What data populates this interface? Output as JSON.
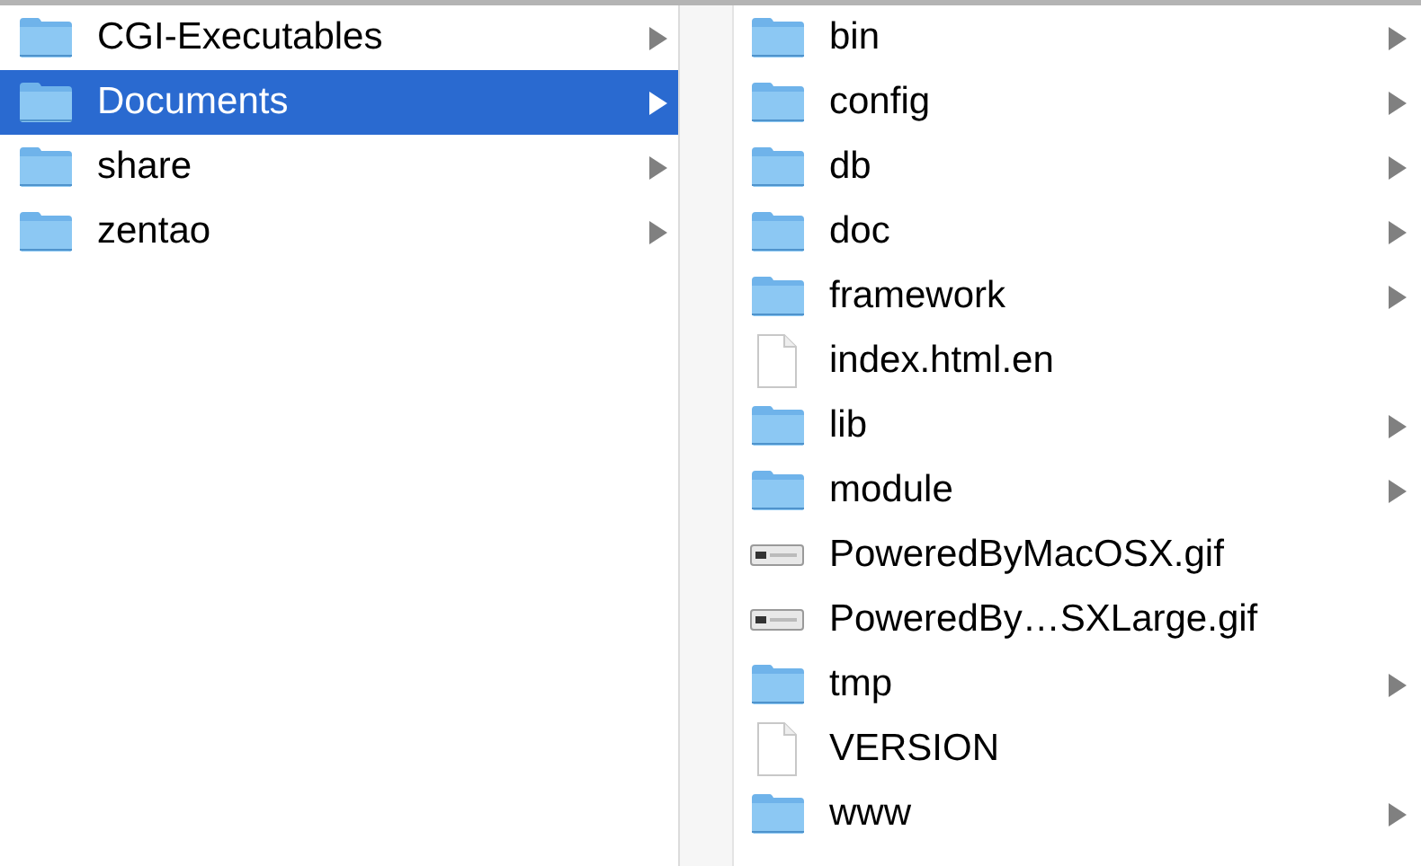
{
  "columns": [
    {
      "items": [
        {
          "name": "CGI-Executables",
          "kind": "folder",
          "selected": false
        },
        {
          "name": "Documents",
          "kind": "folder",
          "selected": true
        },
        {
          "name": "share",
          "kind": "folder",
          "selected": false
        },
        {
          "name": "zentao",
          "kind": "folder",
          "selected": false
        }
      ]
    },
    {
      "items": [
        {
          "name": "bin",
          "kind": "folder",
          "selected": false
        },
        {
          "name": "config",
          "kind": "folder",
          "selected": false
        },
        {
          "name": "db",
          "kind": "folder",
          "selected": false
        },
        {
          "name": "doc",
          "kind": "folder",
          "selected": false
        },
        {
          "name": "framework",
          "kind": "folder",
          "selected": false
        },
        {
          "name": "index.html.en",
          "kind": "document",
          "selected": false
        },
        {
          "name": "lib",
          "kind": "folder",
          "selected": false
        },
        {
          "name": "module",
          "kind": "folder",
          "selected": false
        },
        {
          "name": "PoweredByMacOSX.gif",
          "kind": "image",
          "selected": false
        },
        {
          "name": "PoweredBy…SXLarge.gif",
          "kind": "image",
          "selected": false
        },
        {
          "name": "tmp",
          "kind": "folder",
          "selected": false
        },
        {
          "name": "VERSION",
          "kind": "document",
          "selected": false
        },
        {
          "name": "www",
          "kind": "folder",
          "selected": false
        }
      ]
    }
  ]
}
